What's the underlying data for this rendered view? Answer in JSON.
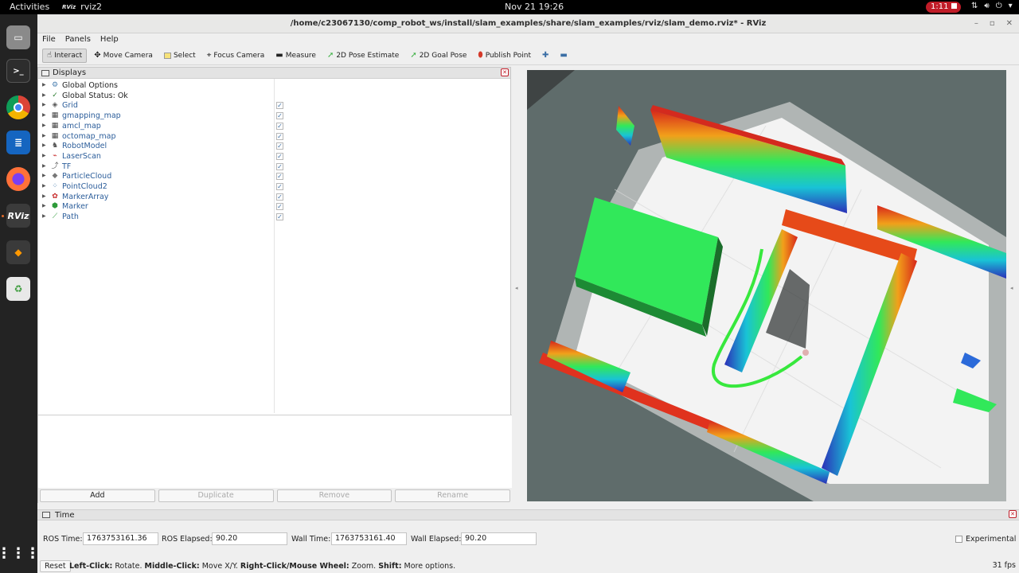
{
  "topbar": {
    "activities": "Activities",
    "app_name": "rviz2",
    "app_icon_text": "RViz",
    "clock": "Nov 21  19:26",
    "recording_time": "1:11"
  },
  "dock": {
    "apps": [
      "files-icon",
      "terminal-icon",
      "chrome-icon",
      "writer-icon",
      "firefox-icon",
      "rviz-icon",
      "sublime-icon",
      "trash-icon"
    ],
    "rviz_label": "RViz"
  },
  "window": {
    "title": "/home/c23067130/comp_robot_ws/install/slam_examples/share/slam_examples/rviz/slam_demo.rviz* - RViz"
  },
  "menu": {
    "file": "File",
    "panels": "Panels",
    "help": "Help"
  },
  "toolbar": {
    "interact": "Interact",
    "move_camera": "Move Camera",
    "select": "Select",
    "focus_camera": "Focus Camera",
    "measure": "Measure",
    "pose_estimate": "2D Pose Estimate",
    "goal_pose": "2D Goal Pose",
    "publish_point": "Publish Point"
  },
  "displays": {
    "title": "Displays",
    "items": [
      {
        "label": "Global Options",
        "icon": "gear-icon",
        "checked": false,
        "link": false
      },
      {
        "label": "Global Status: Ok",
        "icon": "checkmark-icon",
        "checked": false,
        "link": false
      },
      {
        "label": "Grid",
        "icon": "grid-icon",
        "checked": true,
        "link": true
      },
      {
        "label": "gmapping_map",
        "icon": "map-icon",
        "checked": true,
        "link": true
      },
      {
        "label": "amcl_map",
        "icon": "map-icon",
        "checked": true,
        "link": true
      },
      {
        "label": "octomap_map",
        "icon": "map-icon",
        "checked": true,
        "link": true
      },
      {
        "label": "RobotModel",
        "icon": "robot-icon",
        "checked": true,
        "link": true
      },
      {
        "label": "LaserScan",
        "icon": "laser-icon",
        "checked": true,
        "link": true
      },
      {
        "label": "TF",
        "icon": "tf-icon",
        "checked": true,
        "link": true
      },
      {
        "label": "ParticleCloud",
        "icon": "particle-icon",
        "checked": true,
        "link": true
      },
      {
        "label": "PointCloud2",
        "icon": "pointcloud-icon",
        "checked": true,
        "link": true
      },
      {
        "label": "MarkerArray",
        "icon": "markerarray-icon",
        "checked": true,
        "link": true
      },
      {
        "label": "Marker",
        "icon": "marker-icon",
        "checked": true,
        "link": true
      },
      {
        "label": "Path",
        "icon": "path-icon",
        "checked": true,
        "link": true
      }
    ],
    "buttons": {
      "add": "Add",
      "duplicate": "Duplicate",
      "remove": "Remove",
      "rename": "Rename"
    }
  },
  "time": {
    "title": "Time",
    "ros_time_label": "ROS Time:",
    "ros_time": "1763753161.36",
    "ros_elapsed_label": "ROS Elapsed:",
    "ros_elapsed": "90.20",
    "wall_time_label": "Wall Time:",
    "wall_time": "1763753161.40",
    "wall_elapsed_label": "Wall Elapsed:",
    "wall_elapsed": "90.20",
    "experimental": "Experimental"
  },
  "status": {
    "reset": "Reset",
    "hint_left_click": "Left-Click:",
    "hint_left_action": " Rotate. ",
    "hint_middle_click": "Middle-Click:",
    "hint_middle_action": " Move X/Y. ",
    "hint_right_click": "Right-Click/Mouse Wheel:",
    "hint_right_action": " Zoom. ",
    "hint_shift": "Shift:",
    "hint_shift_action": " More options.",
    "fps": "31 fps"
  },
  "colors": {
    "viewport_bg": "#5f6b6a",
    "accent_link": "#2b5d9a",
    "record_red": "#c01c28"
  }
}
